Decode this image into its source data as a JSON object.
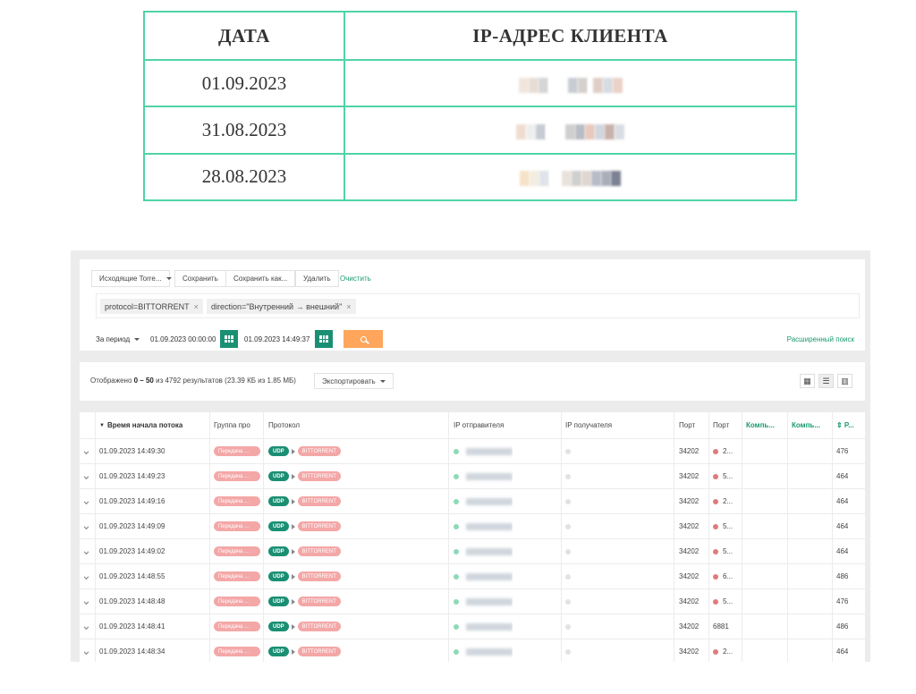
{
  "doc_table": {
    "headers": [
      "ДАТА",
      "IP-АДРЕС КЛИЕНТА"
    ],
    "rows": [
      {
        "date": "01.09.2023"
      },
      {
        "date": "31.08.2023"
      },
      {
        "date": "28.08.2023"
      }
    ]
  },
  "toolbar": {
    "preset": "Исходящие Torre...",
    "save": "Сохранить",
    "save_as": "Сохранить как...",
    "delete": "Удалить",
    "clear": "Очистить"
  },
  "filters": [
    {
      "text": "protocol=BITTORRENT",
      "remove": "×"
    },
    {
      "text": "direction=\"Внутренний → внешний\"",
      "remove": "×"
    }
  ],
  "period": {
    "label": "За период",
    "from": "01.09.2023  00:00:00",
    "to": "01.09.2023  14:49:37",
    "advanced": "Расширенный поиск"
  },
  "summary": {
    "prefix": "Отображено ",
    "range": "0 – 50",
    "suffix": " из 4792 результатов  (23.39 КБ из 1.85 МБ)",
    "export": "Экспортировать"
  },
  "columns": {
    "start_time": "Время начала потока",
    "group": "Группа про",
    "protocol": "Протокол",
    "src_ip": "IP отправителя",
    "dst_ip": "IP получателя",
    "src_port": "Порт",
    "dst_port": "Порт",
    "comp1": "Компь...",
    "comp2": "Компь...",
    "last": "⇕ Р..."
  },
  "cell_labels": {
    "group": "Передача ...",
    "udp": "UDP",
    "bittorrent": "BITTORRENT"
  },
  "rows": [
    {
      "time": "01.09.2023 14:49:30",
      "src_port": "34202",
      "dst_port": "2...",
      "last": "476",
      "dst_dot": true
    },
    {
      "time": "01.09.2023 14:49:23",
      "src_port": "34202",
      "dst_port": "5...",
      "last": "464",
      "dst_dot": true
    },
    {
      "time": "01.09.2023 14:49:16",
      "src_port": "34202",
      "dst_port": "2...",
      "last": "464",
      "dst_dot": true
    },
    {
      "time": "01.09.2023 14:49:09",
      "src_port": "34202",
      "dst_port": "5...",
      "last": "464",
      "dst_dot": true
    },
    {
      "time": "01.09.2023 14:49:02",
      "src_port": "34202",
      "dst_port": "5...",
      "last": "464",
      "dst_dot": true
    },
    {
      "time": "01.09.2023 14:48:55",
      "src_port": "34202",
      "dst_port": "6...",
      "last": "486",
      "dst_dot": true
    },
    {
      "time": "01.09.2023 14:48:48",
      "src_port": "34202",
      "dst_port": "5...",
      "last": "476",
      "dst_dot": true
    },
    {
      "time": "01.09.2023 14:48:41",
      "src_port": "34202",
      "dst_port": "6881",
      "last": "486",
      "dst_dot": false
    },
    {
      "time": "01.09.2023 14:48:34",
      "src_port": "34202",
      "dst_port": "2...",
      "last": "464",
      "dst_dot": true
    }
  ],
  "colors": {
    "accent": "#4fd3a7",
    "primary": "#1a8f73",
    "search": "#ffa65c",
    "tag": "#f4a7a7"
  }
}
